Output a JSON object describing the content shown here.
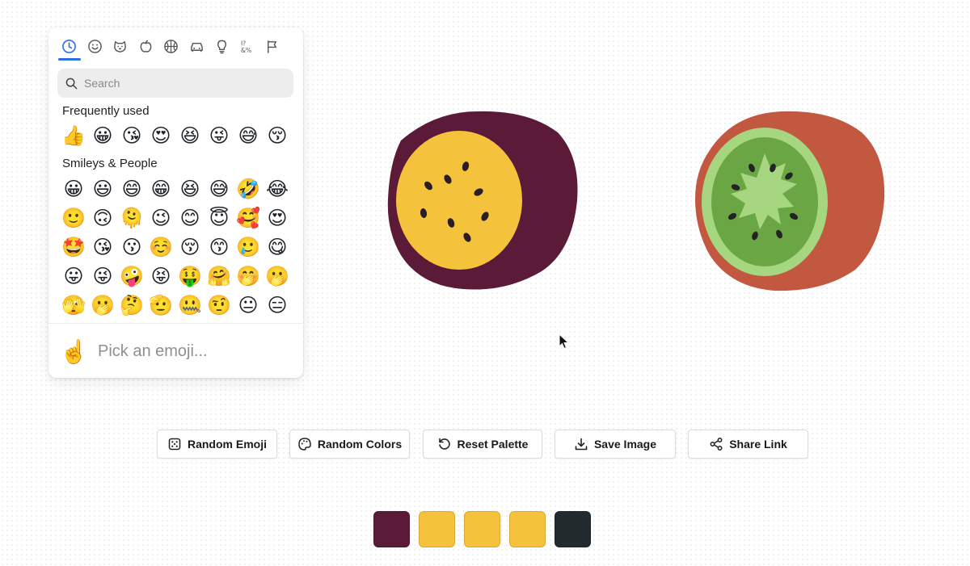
{
  "picker": {
    "categories": [
      {
        "name": "recent",
        "icon": "clock-icon",
        "active": true
      },
      {
        "name": "smileys",
        "icon": "smiley-icon"
      },
      {
        "name": "animals",
        "icon": "dog-icon"
      },
      {
        "name": "food",
        "icon": "apple-icon"
      },
      {
        "name": "activity",
        "icon": "basketball-icon"
      },
      {
        "name": "travel",
        "icon": "car-icon"
      },
      {
        "name": "objects",
        "icon": "lightbulb-icon"
      },
      {
        "name": "symbols",
        "icon": "symbols-icon"
      },
      {
        "name": "flags",
        "icon": "flag-icon"
      }
    ],
    "search_placeholder": "Search",
    "frequently_used_title": "Frequently used",
    "frequently_used": [
      "👍",
      "😀",
      "😘",
      "😍",
      "😆",
      "😜",
      "😅",
      "😚"
    ],
    "smileys_title": "Smileys & People",
    "smileys": [
      "😀",
      "😃",
      "😄",
      "😁",
      "😆",
      "😅",
      "🤣",
      "😂",
      "🙂",
      "🙃",
      "🫠",
      "😉",
      "😊",
      "😇",
      "🥰",
      "😍",
      "🤩",
      "😘",
      "😗",
      "☺️",
      "😚",
      "😙",
      "🥲",
      "😋",
      "😛",
      "😜",
      "🤪",
      "😝",
      "🤑",
      "🤗",
      "🤭",
      "🫢",
      "🫣",
      "🫢",
      "🤔",
      "🫡",
      "🤐",
      "🤨",
      "😐",
      "😑"
    ],
    "footer_emoji": "☝️",
    "footer_text": "Pick an emoji..."
  },
  "canvas": {
    "left_fruit": "passion-fruit",
    "right_fruit": "kiwi"
  },
  "buttons": {
    "random_emoji": "Random Emoji",
    "random_colors": "Random Colors",
    "reset_palette": "Reset Palette",
    "save_image": "Save Image",
    "share_link": "Share Link"
  },
  "palette": [
    "#5b1a37",
    "#f4c23b",
    "#f4c23b",
    "#f4c23b",
    "#232a2e"
  ]
}
